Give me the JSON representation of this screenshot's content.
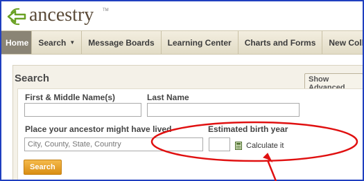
{
  "brand": {
    "name": "ancestry",
    "logo_icon": "leaf-arrow-icon",
    "color": "#6aa124"
  },
  "nav": {
    "items": [
      {
        "label": "Home",
        "active": true
      },
      {
        "label": "Search",
        "has_dropdown": true
      },
      {
        "label": "Message Boards"
      },
      {
        "label": "Learning Center"
      },
      {
        "label": "Charts and Forms"
      },
      {
        "label": "New Collections"
      }
    ]
  },
  "search": {
    "title": "Search",
    "show_advanced_label": "Show Advanced",
    "first_name_label": "First & Middle Name(s)",
    "last_name_label": "Last Name",
    "place_label": "Place your ancestor might have lived",
    "place_placeholder": "City, County, State, Country",
    "birth_year_label": "Estimated birth year",
    "calculate_label": "Calculate it",
    "calculate_icon": "calculator-icon",
    "search_button_label": "Search"
  },
  "colors": {
    "accent_orange": "#e8a22a",
    "annotation_red": "#e01010",
    "frame_blue": "#1f3fbf"
  }
}
